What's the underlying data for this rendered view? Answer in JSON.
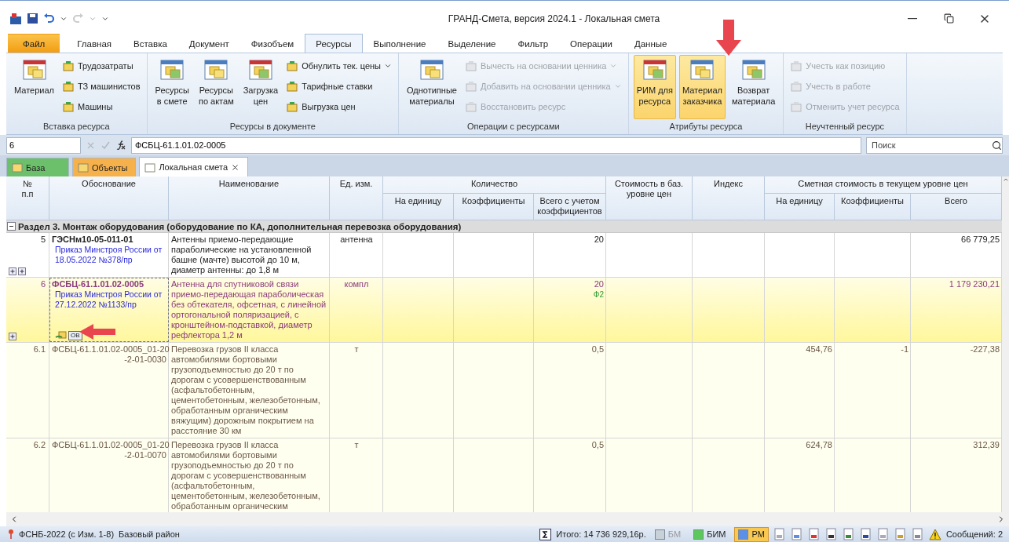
{
  "window": {
    "title": "ГРАНД-Смета, версия 2024.1 - Локальная смета"
  },
  "ribbon_tabs": [
    {
      "label": "Файл",
      "kind": "file",
      "selected": false
    },
    {
      "label": "Главная",
      "kind": "tab",
      "selected": false
    },
    {
      "label": "Вставка",
      "kind": "tab",
      "selected": false
    },
    {
      "label": "Документ",
      "kind": "tab",
      "selected": false
    },
    {
      "label": "Физобъем",
      "kind": "tab",
      "selected": false
    },
    {
      "label": "Ресурсы",
      "kind": "tab",
      "selected": true
    },
    {
      "label": "Выполнение",
      "kind": "tab",
      "selected": false
    },
    {
      "label": "Выделение",
      "kind": "tab",
      "selected": false
    },
    {
      "label": "Фильтр",
      "kind": "tab",
      "selected": false
    },
    {
      "label": "Операции",
      "kind": "tab",
      "selected": false
    },
    {
      "label": "Данные",
      "kind": "tab",
      "selected": false
    }
  ],
  "ribbon_groups": [
    {
      "label": "Вставка ресурса",
      "items": [
        {
          "label": "Материал",
          "kind": "large",
          "disabled": false,
          "selected": false
        },
        {
          "label": "Трудозатраты",
          "kind": "small",
          "disabled": false
        },
        {
          "label": "ТЗ машинистов",
          "kind": "small",
          "disabled": false
        },
        {
          "label": "Машины",
          "kind": "small",
          "disabled": false
        }
      ]
    },
    {
      "label": "Ресурсы в документе",
      "items": [
        {
          "label": "Ресурсы\nв смете",
          "kind": "large",
          "disabled": false,
          "selected": false
        },
        {
          "label": "Ресурсы\nпо актам",
          "kind": "large",
          "disabled": false,
          "selected": false
        },
        {
          "label": "Загрузка\nцен",
          "kind": "large",
          "disabled": false,
          "selected": false
        },
        {
          "label": "Обнулить тек. цены",
          "kind": "small",
          "disabled": false,
          "dropdown": true
        },
        {
          "label": "Тарифные ставки",
          "kind": "small",
          "disabled": false
        },
        {
          "label": "Выгрузка цен",
          "kind": "small",
          "disabled": false
        }
      ]
    },
    {
      "label": "Операции с ресурсами",
      "items": [
        {
          "label": "Однотипные\nматериалы",
          "kind": "large",
          "disabled": false,
          "selected": false
        },
        {
          "label": "Вычесть на основании ценника",
          "kind": "small",
          "disabled": true,
          "dropdown": true
        },
        {
          "label": "Добавить на основании ценника",
          "kind": "small",
          "disabled": true,
          "dropdown": true
        },
        {
          "label": "Восстановить ресурс",
          "kind": "small",
          "disabled": true
        }
      ]
    },
    {
      "label": "Атрибуты ресурса",
      "items": [
        {
          "label": "РИМ для\nресурса",
          "kind": "large",
          "disabled": false,
          "selected": true
        },
        {
          "label": "Материал\nзаказчика",
          "kind": "large",
          "disabled": false,
          "selected": true
        },
        {
          "label": "Возврат\nматериала",
          "kind": "large",
          "disabled": false,
          "selected": false
        }
      ]
    },
    {
      "label": "Неучтенный ресурс",
      "items": [
        {
          "label": "Учесть как позицию",
          "kind": "small",
          "disabled": true
        },
        {
          "label": "Учесть в работе",
          "kind": "small",
          "disabled": true
        },
        {
          "label": "Отменить учет ресурса",
          "kind": "small",
          "disabled": true
        }
      ]
    }
  ],
  "formula_bar": {
    "cell": "6",
    "formula": "ФСБЦ-61.1.01.02-0005"
  },
  "search": {
    "placeholder": "Поиск"
  },
  "doc_tabs": [
    {
      "label": "База",
      "kind": "base",
      "selected": false
    },
    {
      "label": "Объекты",
      "kind": "objects",
      "selected": false
    },
    {
      "label": "Локальная смета",
      "kind": "document",
      "selected": true
    }
  ],
  "table": {
    "columns": [
      {
        "label": "№\nп.п"
      },
      {
        "label": "Обоснование"
      },
      {
        "label": "Наименование"
      },
      {
        "label": "Ед. изм."
      },
      {
        "label": "Количество",
        "children": [
          "На единицу",
          "Коэффициенты",
          "Всего с учетом коэффициентов"
        ]
      },
      {
        "label": "Стоимость в баз. уровне цен"
      },
      {
        "label": "Индекс"
      },
      {
        "label": "Сметная стоимость в текущем уровне цен",
        "children": [
          "На единицу",
          "Коэффициенты",
          "Всего"
        ]
      }
    ],
    "rows": [
      {
        "kind": "section",
        "label": "Раздел 3. Монтаж оборудования (оборудование по КА, дополнительная перевозка оборудования)",
        "expanded": true
      },
      {
        "kind": "work",
        "selected": false,
        "number": "5",
        "code_lines": [
          "ГЭСНм10-05-011-01"
        ],
        "order": "Приказ Минстроя России от 18.05.2022 №378/пр",
        "name": "Антенны приемо-передающие параболические на установленной башне (мачте) высотой до 10 м, диаметр антенны: до 1,8 м",
        "unit": "антенна",
        "qty_total": "20",
        "price_total": "66 779,25",
        "expanders": [
          {
            "expanded": false
          },
          {
            "expanded": false
          }
        ]
      },
      {
        "kind": "material",
        "selected": true,
        "number": "6",
        "code_lines": [
          "ФСБЦ-61.1.01.02-0005"
        ],
        "order": "Приказ Минстроя России от 27.12.2022 №1133/пр",
        "name": "Антенна для спутниковой связи приемо-передающая параболическая без обтекателя, офсетная, с линейной ортогональной поляризацией, с кронштейном-подставкой, диаметр рефлектора 1,2 м",
        "unit": "компл",
        "qty_total": "20",
        "qty_note": "Ф2",
        "price_total": "1 179 230,21",
        "badge": "ОВ",
        "expanders": [
          {
            "expanded": false
          }
        ]
      },
      {
        "kind": "transport",
        "selected": false,
        "number": "6.1",
        "code_lines": [
          "ФСБЦ-61.1.01.02-0005_01-20",
          "-2-01-0030"
        ],
        "name": "Перевозка грузов II класса автомобилями бортовыми грузоподъемностью до 20 т по дорогам с усовершенствованным (асфальтобетонным, цементобетонным, железобетонным, обработанным органическим вяжущим) дорожным покрытием на расстояние 30 км",
        "unit": "т",
        "qty_total": "0,5",
        "price_unit": "454,76",
        "price_coef": "-1",
        "price_total": "-227,38"
      },
      {
        "kind": "transport",
        "selected": false,
        "number": "6.2",
        "code_lines": [
          "ФСБЦ-61.1.01.02-0005_01-20",
          "-2-01-0070"
        ],
        "name": "Перевозка грузов II класса автомобилями бортовыми грузоподъемностью до 20 т по дорогам с усовершенствованным (асфальтобетонным, цементобетонным, железобетонным, обработанным органическим",
        "unit": "т",
        "qty_total": "0,5",
        "price_unit": "624,78",
        "price_total": "312,39"
      }
    ]
  },
  "status_bar": {
    "norm_base": "ФСНБ-2022 (с Изм. 1-8)",
    "region": "Базовый район",
    "total": "Итого: 14 736 929,16р.",
    "toggles": [
      {
        "label": "БМ",
        "disabled": true,
        "selected": false,
        "color": "#c8d0d8"
      },
      {
        "label": "БИМ",
        "disabled": false,
        "selected": false,
        "color": "#5cc85c"
      },
      {
        "label": "РМ",
        "disabled": false,
        "selected": true,
        "color": "#5b8fe8"
      }
    ],
    "messages": "Сообщений: 2"
  }
}
